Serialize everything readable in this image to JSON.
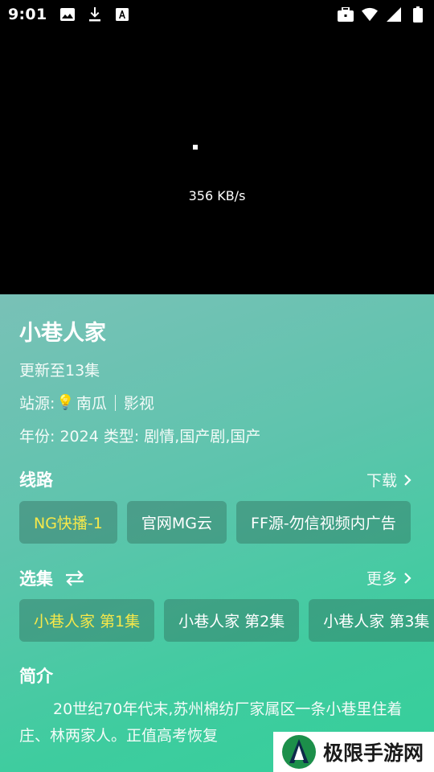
{
  "status_bar": {
    "time": "9:01",
    "left_icons": [
      "image-icon",
      "download-icon",
      "font-icon"
    ],
    "right_icons": [
      "briefcase-icon",
      "wifi-icon",
      "signal-icon",
      "battery-icon"
    ]
  },
  "player": {
    "speed": "356 KB/s"
  },
  "detail": {
    "title": "小巷人家",
    "update": "更新至13集",
    "source_label": "站源:",
    "source_name": "南瓜",
    "source_type": "影视",
    "year_text": "年份: 2024  类型: 剧情,国产剧,国产"
  },
  "lines": {
    "title": "线路",
    "download_label": "下载",
    "items": [
      {
        "label": "NG快播-1",
        "active": true
      },
      {
        "label": "官网MG云",
        "active": false
      },
      {
        "label": "FF源-勿信视频内广告",
        "active": false
      }
    ]
  },
  "episodes": {
    "title": "选集",
    "more_label": "更多",
    "items": [
      {
        "label": "小巷人家 第1集",
        "active": true
      },
      {
        "label": "小巷人家 第2集",
        "active": false
      },
      {
        "label": "小巷人家 第3集",
        "active": false
      }
    ]
  },
  "intro": {
    "title": "简介",
    "text": "20世纪70年代末,苏州棉纺厂家属区一条小巷里住着庄、林两家人。正值高考恢复"
  },
  "watermark": {
    "text": "极限手游网"
  },
  "colors": {
    "panel_start": "#79c1b7",
    "panel_end": "#34cf9a",
    "active_chip_text": "#f6e84a"
  }
}
